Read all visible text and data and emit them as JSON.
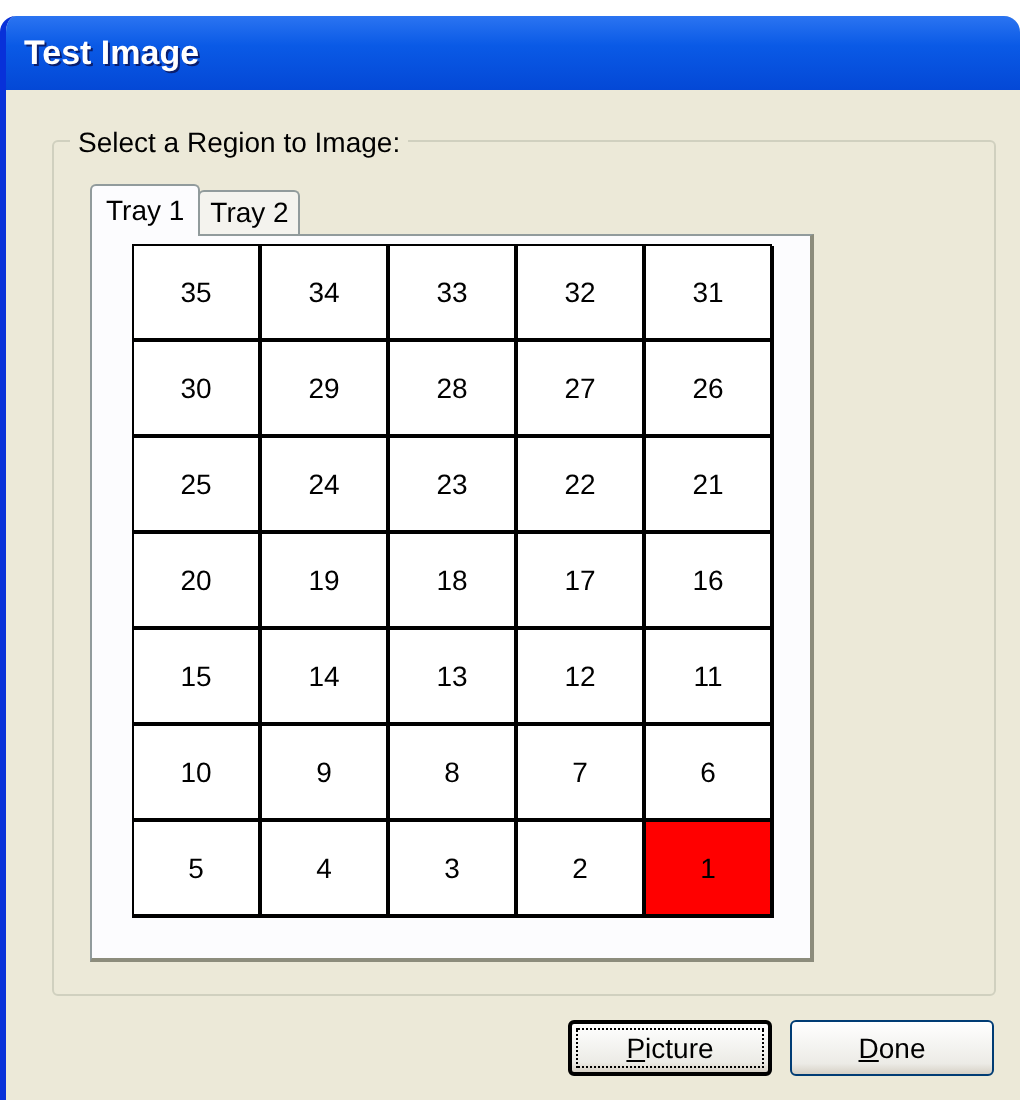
{
  "window": {
    "title": "Test Image"
  },
  "group": {
    "label": "Select a Region to Image:"
  },
  "tabs": [
    {
      "label": "Tray 1",
      "selected": true
    },
    {
      "label": "Tray 2",
      "selected": false
    }
  ],
  "grid": [
    [
      {
        "label": "35",
        "selected": false
      },
      {
        "label": "34",
        "selected": false
      },
      {
        "label": "33",
        "selected": false
      },
      {
        "label": "32",
        "selected": false
      },
      {
        "label": "31",
        "selected": false
      }
    ],
    [
      {
        "label": "30",
        "selected": false
      },
      {
        "label": "29",
        "selected": false
      },
      {
        "label": "28",
        "selected": false
      },
      {
        "label": "27",
        "selected": false
      },
      {
        "label": "26",
        "selected": false
      }
    ],
    [
      {
        "label": "25",
        "selected": false
      },
      {
        "label": "24",
        "selected": false
      },
      {
        "label": "23",
        "selected": false
      },
      {
        "label": "22",
        "selected": false
      },
      {
        "label": "21",
        "selected": false
      }
    ],
    [
      {
        "label": "20",
        "selected": false
      },
      {
        "label": "19",
        "selected": false
      },
      {
        "label": "18",
        "selected": false
      },
      {
        "label": "17",
        "selected": false
      },
      {
        "label": "16",
        "selected": false
      }
    ],
    [
      {
        "label": "15",
        "selected": false
      },
      {
        "label": "14",
        "selected": false
      },
      {
        "label": "13",
        "selected": false
      },
      {
        "label": "12",
        "selected": false
      },
      {
        "label": "11",
        "selected": false
      }
    ],
    [
      {
        "label": "10",
        "selected": false
      },
      {
        "label": "9",
        "selected": false
      },
      {
        "label": "8",
        "selected": false
      },
      {
        "label": "7",
        "selected": false
      },
      {
        "label": "6",
        "selected": false
      }
    ],
    [
      {
        "label": "5",
        "selected": false
      },
      {
        "label": "4",
        "selected": false
      },
      {
        "label": "3",
        "selected": false
      },
      {
        "label": "2",
        "selected": false
      },
      {
        "label": "1",
        "selected": true
      }
    ]
  ],
  "buttons": [
    {
      "label": "Picture",
      "default": true
    },
    {
      "label": "Done",
      "default": false
    }
  ]
}
